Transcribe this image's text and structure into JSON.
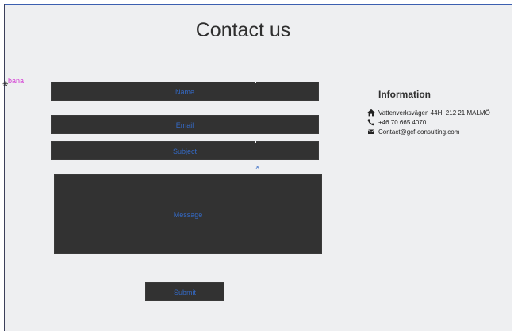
{
  "page": {
    "title": "Contact us",
    "stray_label": "bana",
    "close_mark": "×"
  },
  "form": {
    "name_placeholder": "Name",
    "email_placeholder": "Email",
    "subject_placeholder": "Subject",
    "message_placeholder": "Message",
    "submit_label": "Submit"
  },
  "information": {
    "heading": "Information",
    "address": "Vattenverksvägen 44H, 212 21 MALMÖ",
    "phone": "+46 70 665 4070",
    "email": "Contact@gcf-consulting.com",
    "icons": [
      "home-icon",
      "phone-icon",
      "envelope-icon"
    ]
  },
  "colors": {
    "background": "#eeeff1",
    "field": "#323232",
    "placeholder_text": "#3469c4",
    "title_text": "#2f2f2f",
    "stray_label": "#d236d2"
  }
}
